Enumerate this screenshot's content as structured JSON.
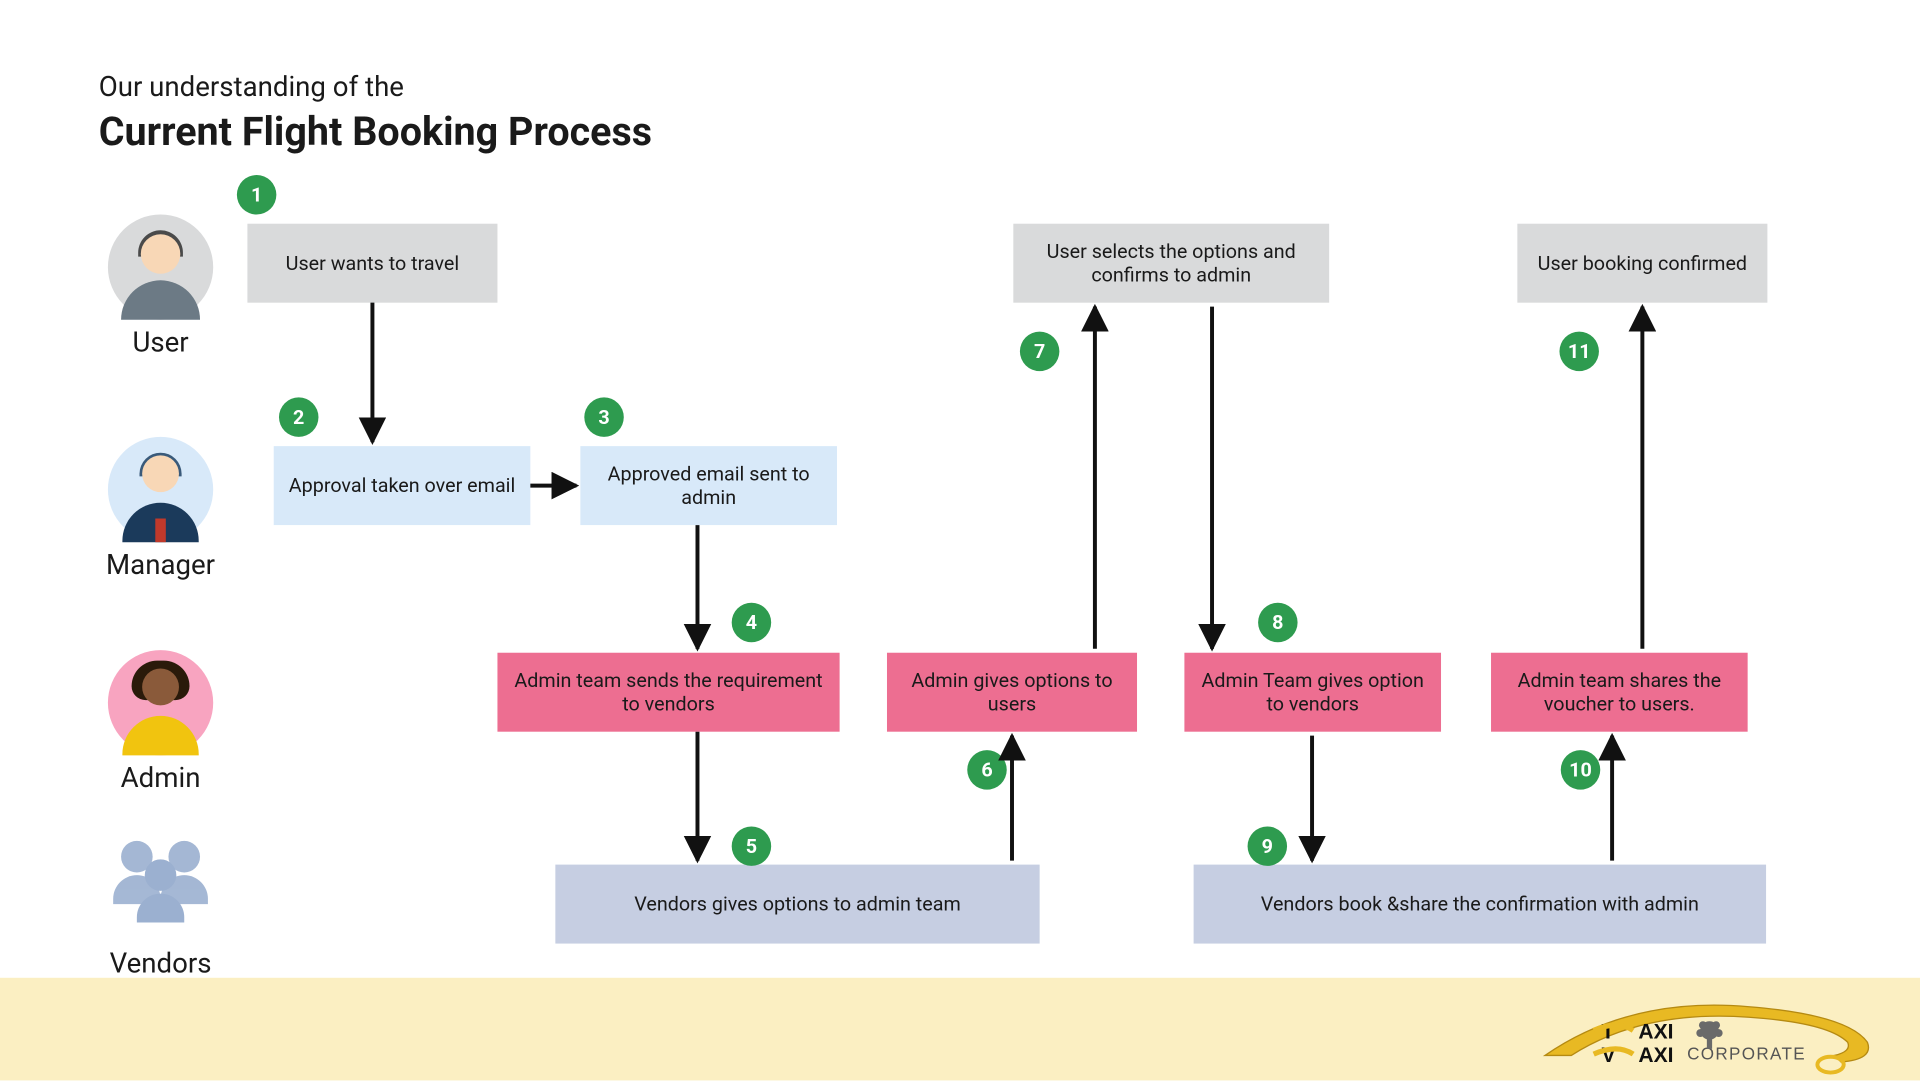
{
  "pretitle": "Our understanding of the",
  "title": "Current Flight Booking Process",
  "lanes": {
    "user": {
      "label": "User"
    },
    "manager": {
      "label": "Manager"
    },
    "admin": {
      "label": "Admin"
    },
    "vendors": {
      "label": "Vendors"
    }
  },
  "nodes": {
    "n1": "User wants to travel",
    "n2": "Approval taken over email",
    "n3": "Approved email sent to admin",
    "n4": "Admin team sends the requirement to vendors",
    "n5": "Vendors gives options to admin team",
    "n6": "Admin gives options to users",
    "n7": "User selects the options and confirms to admin",
    "n8": "Admin Team gives option to vendors",
    "n9": "Vendors book &share the confirmation with admin",
    "n10": "Admin team shares the voucher to users.",
    "n11": "User booking confirmed"
  },
  "badges": {
    "b1": "1",
    "b2": "2",
    "b3": "3",
    "b4": "4",
    "b5": "5",
    "b6": "6",
    "b7": "7",
    "b8": "8",
    "b9": "9",
    "b10": "10",
    "b11": "11"
  },
  "logo": {
    "line1a": "T",
    "line1b": "AXI",
    "line2a": "V",
    "line2b": "AXI",
    "suffix": "CORPORATE"
  },
  "colors": {
    "badge": "#2e9b4f",
    "userLane": "#d9dadb",
    "managerLane": "#d8e9f9",
    "adminLane": "#ed6e91",
    "vendorLane": "#c6cee2",
    "footer": "#fbefc2",
    "logoYellow": "#e8b923"
  }
}
